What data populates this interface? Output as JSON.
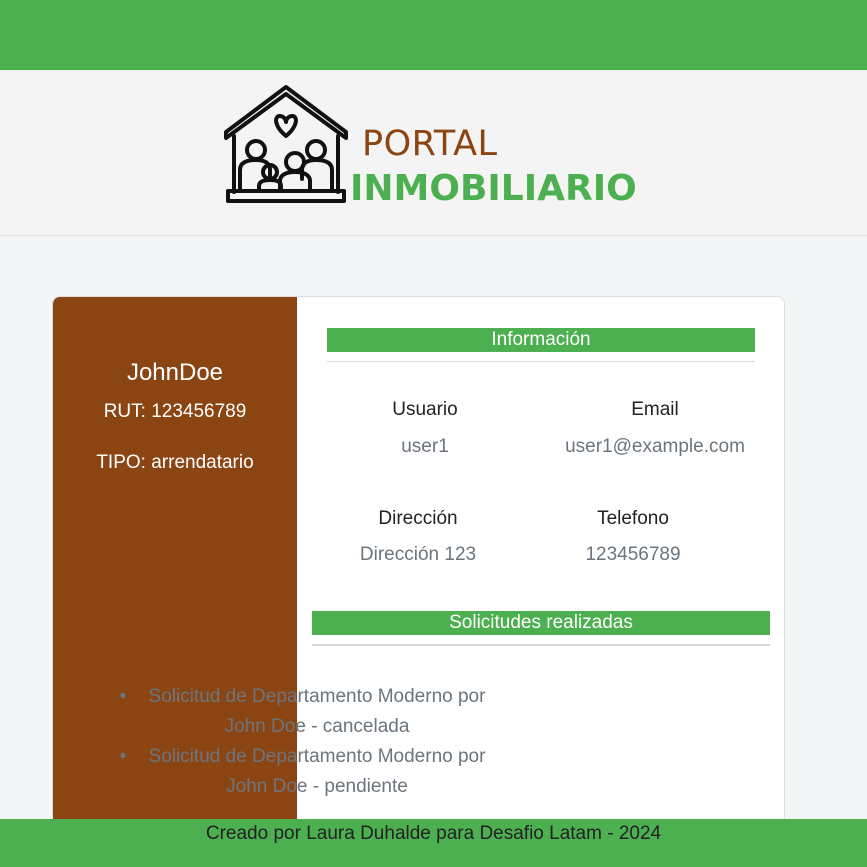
{
  "brand": {
    "line1": "PORTAL",
    "line2": "INMOBILIARIO",
    "colors": {
      "green": "#4caf50",
      "brown": "#8b4513"
    }
  },
  "profile": {
    "username": "JohnDoe",
    "rut": "RUT: 123456789",
    "tipo": "TIPO: arrendatario"
  },
  "info": {
    "title": "Información",
    "fields": [
      {
        "label": "Usuario",
        "value": "user1"
      },
      {
        "label": "Email",
        "value": "user1@example.com"
      },
      {
        "label": "Dirección",
        "value": "Dirección 123"
      },
      {
        "label": "Telefono",
        "value": "123456789"
      }
    ]
  },
  "requests": {
    "title": "Solicitudes realizadas",
    "items": [
      {
        "line1": "Solicitud de Departamento Moderno por",
        "line2": "John Doe - cancelada"
      },
      {
        "line1": "Solicitud de Departamento Moderno por",
        "line2": "John Doe - pendiente"
      }
    ]
  },
  "footer": {
    "text": "Creado por Laura Duhalde para Desafio Latam - 2024"
  },
  "icons": {
    "logo": "house-family-heart-icon",
    "bullet": "bullet-icon"
  }
}
